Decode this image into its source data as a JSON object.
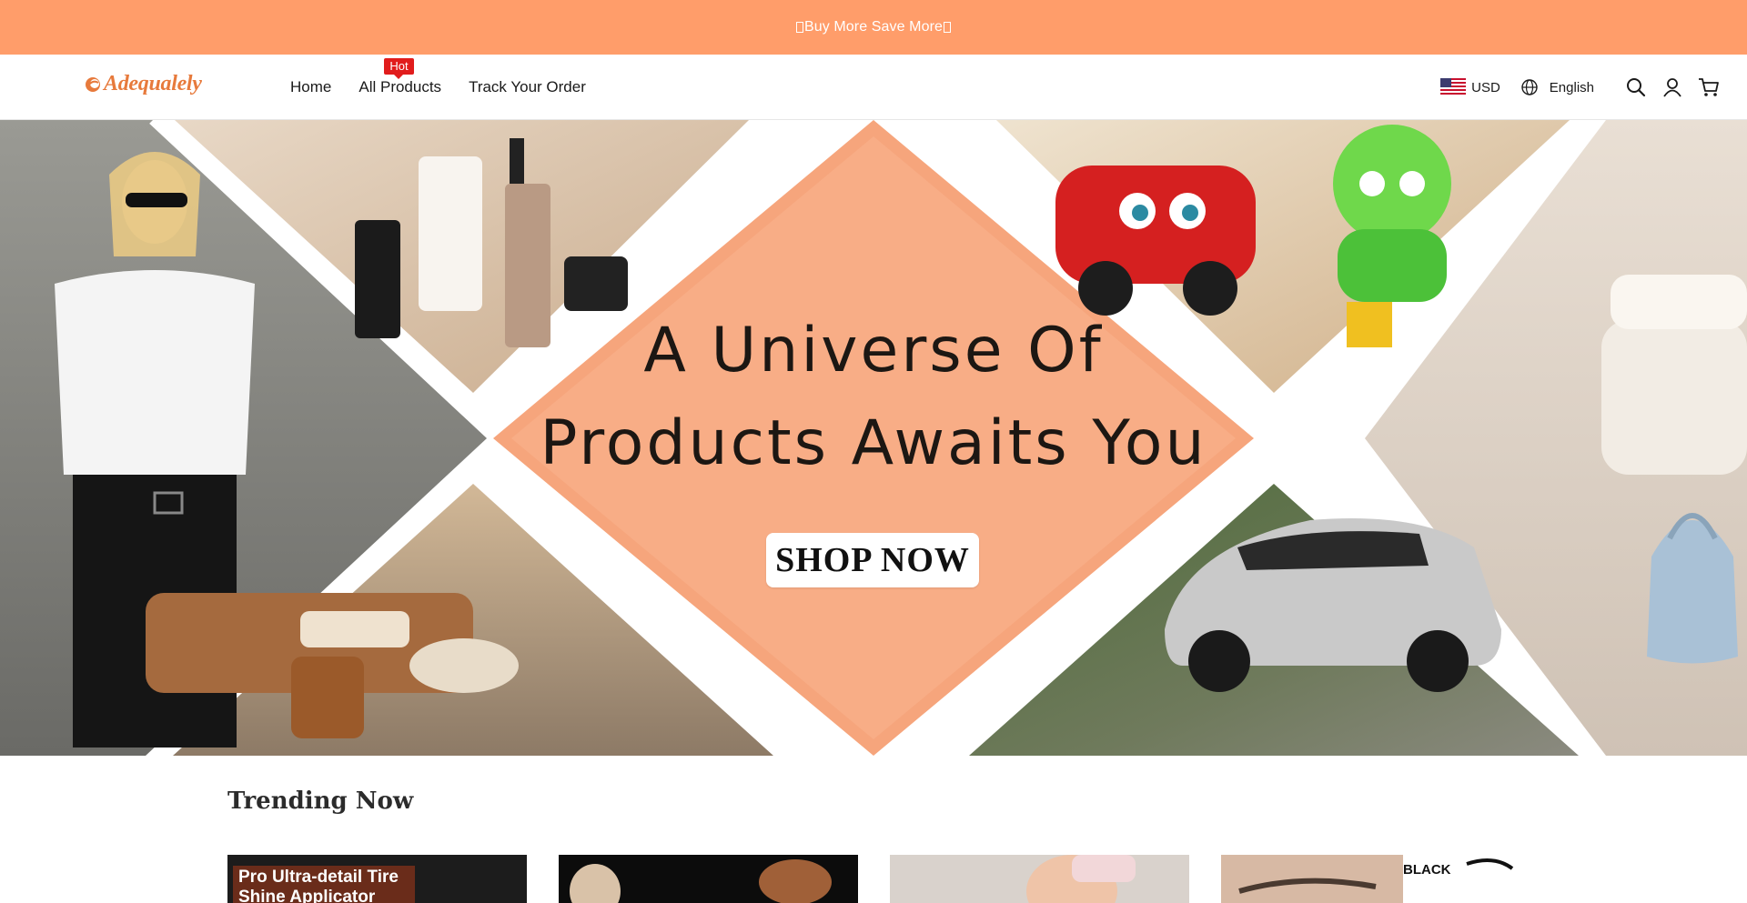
{
  "announcement": {
    "text": "Buy More Save More"
  },
  "header": {
    "logo_text": "Adequalely",
    "nav": [
      {
        "label": "Home"
      },
      {
        "label": "All Products",
        "badge": "Hot"
      },
      {
        "label": "Track Your Order"
      }
    ],
    "currency": "USD",
    "language": "English",
    "icons": [
      "globe-icon",
      "search-icon",
      "account-icon",
      "cart-icon"
    ]
  },
  "hero": {
    "title_line1": "A Universe Of",
    "title_line2": "Products Awaits You",
    "cta": "SHOP NOW"
  },
  "trending": {
    "title": "Trending Now",
    "cards": [
      {
        "label": "Pro Ultra-detail Tire Shine Applicator"
      },
      {
        "label": ""
      },
      {
        "label": ""
      },
      {
        "label": "BLACK"
      }
    ]
  },
  "colors": {
    "announce_bg": "#ff9d6a",
    "brand": "#e77a3c",
    "hot_badge": "#e11c1c",
    "hero_diamond": "#f6a57c"
  }
}
